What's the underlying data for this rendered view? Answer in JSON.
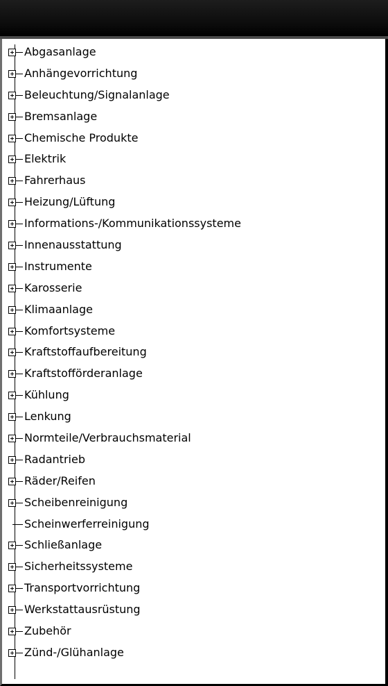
{
  "tree": {
    "items": [
      {
        "label": "Abgasanlage",
        "expandable": true
      },
      {
        "label": "Anhängevorrichtung",
        "expandable": true
      },
      {
        "label": "Beleuchtung/Signalanlage",
        "expandable": true
      },
      {
        "label": "Bremsanlage",
        "expandable": true
      },
      {
        "label": "Chemische Produkte",
        "expandable": true
      },
      {
        "label": "Elektrik",
        "expandable": true
      },
      {
        "label": "Fahrerhaus",
        "expandable": true
      },
      {
        "label": "Heizung/Lüftung",
        "expandable": true
      },
      {
        "label": "Informations-/Kommunikationssysteme",
        "expandable": true
      },
      {
        "label": "Innenausstattung",
        "expandable": true
      },
      {
        "label": "Instrumente",
        "expandable": true
      },
      {
        "label": "Karosserie",
        "expandable": true
      },
      {
        "label": "Klimaanlage",
        "expandable": true
      },
      {
        "label": "Komfortsysteme",
        "expandable": true
      },
      {
        "label": "Kraftstoffaufbereitung",
        "expandable": true
      },
      {
        "label": "Kraftstofförderanlage",
        "expandable": true
      },
      {
        "label": "Kühlung",
        "expandable": true
      },
      {
        "label": "Lenkung",
        "expandable": true
      },
      {
        "label": "Normteile/Verbrauchsmaterial",
        "expandable": true
      },
      {
        "label": "Radantrieb",
        "expandable": true
      },
      {
        "label": "Räder/Reifen",
        "expandable": true
      },
      {
        "label": "Scheibenreinigung",
        "expandable": true
      },
      {
        "label": "Scheinwerferreinigung",
        "expandable": false
      },
      {
        "label": "Schließanlage",
        "expandable": true
      },
      {
        "label": "Sicherheitssysteme",
        "expandable": true
      },
      {
        "label": "Transportvorrichtung",
        "expandable": true
      },
      {
        "label": "Werkstattausrüstung",
        "expandable": true
      },
      {
        "label": "Zubehör",
        "expandable": true
      },
      {
        "label": "Zünd-/Glühanlage",
        "expandable": true
      }
    ]
  },
  "icons": {
    "expand": "plus-box-icon",
    "leaf": "tree-connector-icon"
  },
  "colors": {
    "header_bg": "#0b0b0b",
    "panel_bg": "#ffffff",
    "text": "#000000"
  }
}
